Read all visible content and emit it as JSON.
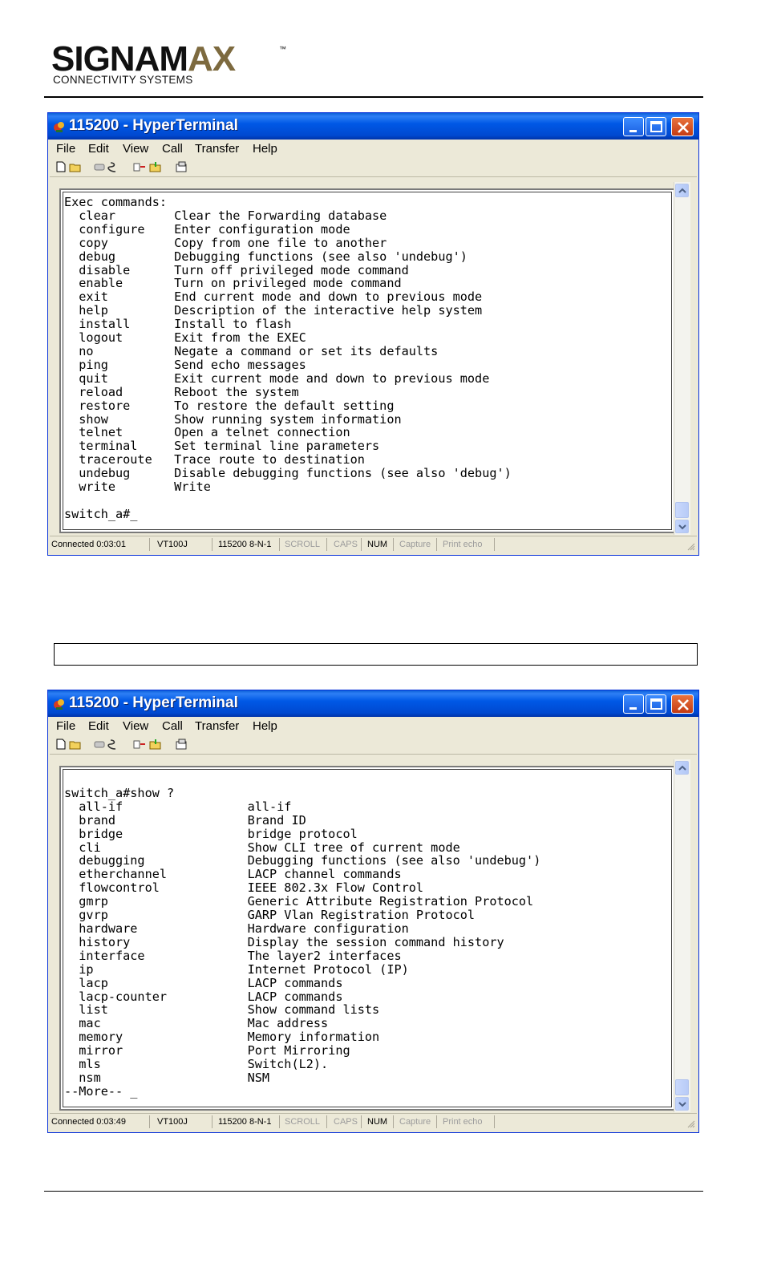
{
  "logo": {
    "word_main": "SIGNAM",
    "word_accent": "AX",
    "tm": "™",
    "subtitle": "CONNECTIVITY SYSTEMS"
  },
  "caption_box": "",
  "colors": {
    "title_bar": "#0058e6",
    "close_button": "#d95a27",
    "logo_accent": "#7d6a3f",
    "window_face": "#ece9d8"
  },
  "windows": [
    {
      "title": "115200 - HyperTerminal",
      "menu": [
        "File",
        "Edit",
        "View",
        "Call",
        "Transfer",
        "Help"
      ],
      "toolbar_icons": [
        "new-icon",
        "open-icon",
        "connect-icon",
        "disconnect-icon",
        "send-icon",
        "receive-icon",
        "properties-icon"
      ],
      "terminal_text": "Exec commands:\n  clear        Clear the Forwarding database\n  configure    Enter configuration mode\n  copy         Copy from one file to another\n  debug        Debugging functions (see also 'undebug')\n  disable      Turn off privileged mode command\n  enable       Turn on privileged mode command\n  exit         End current mode and down to previous mode\n  help         Description of the interactive help system\n  install      Install to flash\n  logout       Exit from the EXEC\n  no           Negate a command or set its defaults\n  ping         Send echo messages\n  quit         Exit current mode and down to previous mode\n  reload       Reboot the system\n  restore      To restore the default setting\n  show         Show running system information\n  telnet       Open a telnet connection\n  terminal     Set terminal line parameters\n  traceroute   Trace route to destination\n  undebug      Disable debugging functions (see also 'debug')\n  write        Write\n\nswitch_a#_",
      "status": {
        "connected": "Connected 0:03:01",
        "emulation": "VT100J",
        "settings": "115200 8-N-1",
        "scroll": "SCROLL",
        "caps": "CAPS",
        "num": "NUM",
        "capture": "Capture",
        "print_echo": "Print echo"
      }
    },
    {
      "title": "115200 - HyperTerminal",
      "menu": [
        "File",
        "Edit",
        "View",
        "Call",
        "Transfer",
        "Help"
      ],
      "toolbar_icons": [
        "new-icon",
        "open-icon",
        "connect-icon",
        "disconnect-icon",
        "send-icon",
        "receive-icon",
        "properties-icon"
      ],
      "terminal_text": "\nswitch_a#show ?\n  all-if                 all-if\n  brand                  Brand ID\n  bridge                 bridge protocol\n  cli                    Show CLI tree of current mode\n  debugging              Debugging functions (see also 'undebug')\n  etherchannel           LACP channel commands\n  flowcontrol            IEEE 802.3x Flow Control\n  gmrp                   Generic Attribute Registration Protocol\n  gvrp                   GARP Vlan Registration Protocol\n  hardware               Hardware configuration\n  history                Display the session command history\n  interface              The layer2 interfaces\n  ip                     Internet Protocol (IP)\n  lacp                   LACP commands\n  lacp-counter           LACP commands\n  list                   Show command lists\n  mac                    Mac address\n  memory                 Memory information\n  mirror                 Port Mirroring\n  mls                    Switch(L2).\n  nsm                    NSM\n--More-- _",
      "status": {
        "connected": "Connected 0:03:49",
        "emulation": "VT100J",
        "settings": "115200 8-N-1",
        "scroll": "SCROLL",
        "caps": "CAPS",
        "num": "NUM",
        "capture": "Capture",
        "print_echo": "Print echo"
      }
    }
  ]
}
